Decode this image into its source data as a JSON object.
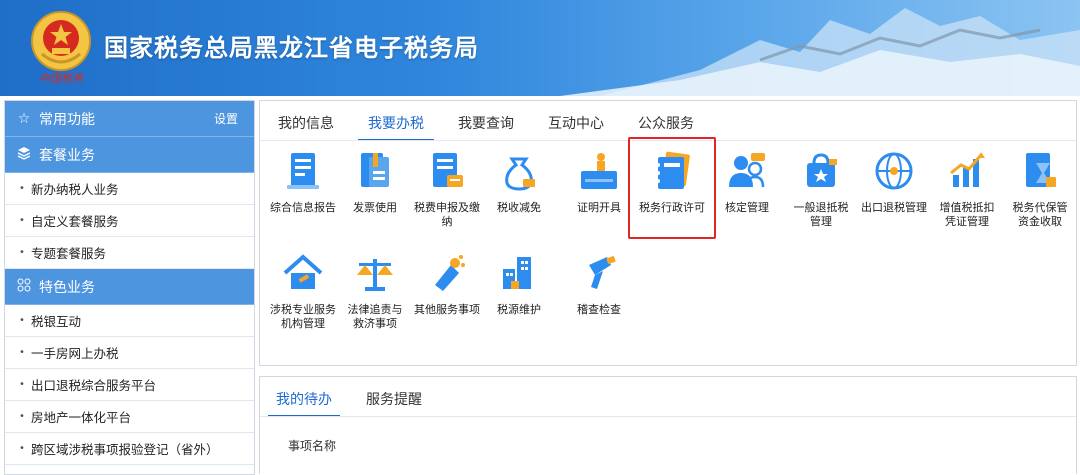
{
  "header": {
    "title": "国家税务总局黑龙江省电子税务局",
    "emblem_caption": "中国税务"
  },
  "sidebar": {
    "sections": [
      {
        "icon": "star-icon",
        "label": "常用功能",
        "action": "设置"
      },
      {
        "icon": "layers-icon",
        "label": "套餐业务",
        "items": [
          "新办纳税人业务",
          "自定义套餐服务",
          "专题套餐服务"
        ]
      },
      {
        "icon": "grid-icon",
        "label": "特色业务",
        "items": [
          "税银互动",
          "一手房网上办税",
          "出口退税综合服务平台",
          "房地产一体化平台",
          "跨区域涉税事项报验登记（省外）"
        ]
      }
    ]
  },
  "main": {
    "tabs": [
      {
        "label": "我的信息",
        "active": false
      },
      {
        "label": "我要办税",
        "active": true
      },
      {
        "label": "我要查询",
        "active": false
      },
      {
        "label": "互动中心",
        "active": false
      },
      {
        "label": "公众服务",
        "active": false
      }
    ],
    "tiles": [
      {
        "icon": "report-icon",
        "label1": "综合信息报告",
        "label2": ""
      },
      {
        "icon": "invoice-icon",
        "label1": "发票使用",
        "label2": ""
      },
      {
        "icon": "declaration-icon",
        "label1": "税费申报及缴纳",
        "label2": ""
      },
      {
        "icon": "money-bag-icon",
        "label1": "税收减免",
        "label2": ""
      },
      {
        "icon": "certificate-icon",
        "label1": "证明开具",
        "label2": ""
      },
      {
        "icon": "notebook-icon",
        "label1": "税务行政许可",
        "label2": ""
      },
      {
        "icon": "users-icon",
        "label1": "核定管理",
        "label2": ""
      },
      {
        "icon": "bag-star-icon",
        "label1": "一般退抵税",
        "label2": "管理"
      },
      {
        "icon": "globe-icon",
        "label1": "出口退税管理",
        "label2": ""
      },
      {
        "icon": "chart-up-icon",
        "label1": "增值税抵扣",
        "label2": "凭证管理"
      },
      {
        "icon": "hourglass-icon",
        "label1": "税务代保管",
        "label2": "资金收取"
      },
      {
        "icon": "house-tools-icon",
        "label1": "涉税专业服务",
        "label2": "机构管理"
      },
      {
        "icon": "scales-icon",
        "label1": "法律追责与",
        "label2": "救济事项"
      },
      {
        "icon": "spray-icon",
        "label1": "其他服务事项",
        "label2": ""
      },
      {
        "icon": "buildings-icon",
        "label1": "税源维护",
        "label2": ""
      },
      {
        "icon": "brush-icon",
        "label1": "稽查检查",
        "label2": ""
      }
    ]
  },
  "todo": {
    "tabs": [
      {
        "label": "我的待办",
        "active": true
      },
      {
        "label": "服务提醒",
        "active": false
      }
    ],
    "column_header": "事项名称"
  },
  "colors": {
    "accent": "#1e6ad2",
    "sidebar_header": "#4e95e0",
    "highlight": "#e02525",
    "icon_blue": "#2d8cf0",
    "icon_orange": "#f5a623"
  }
}
